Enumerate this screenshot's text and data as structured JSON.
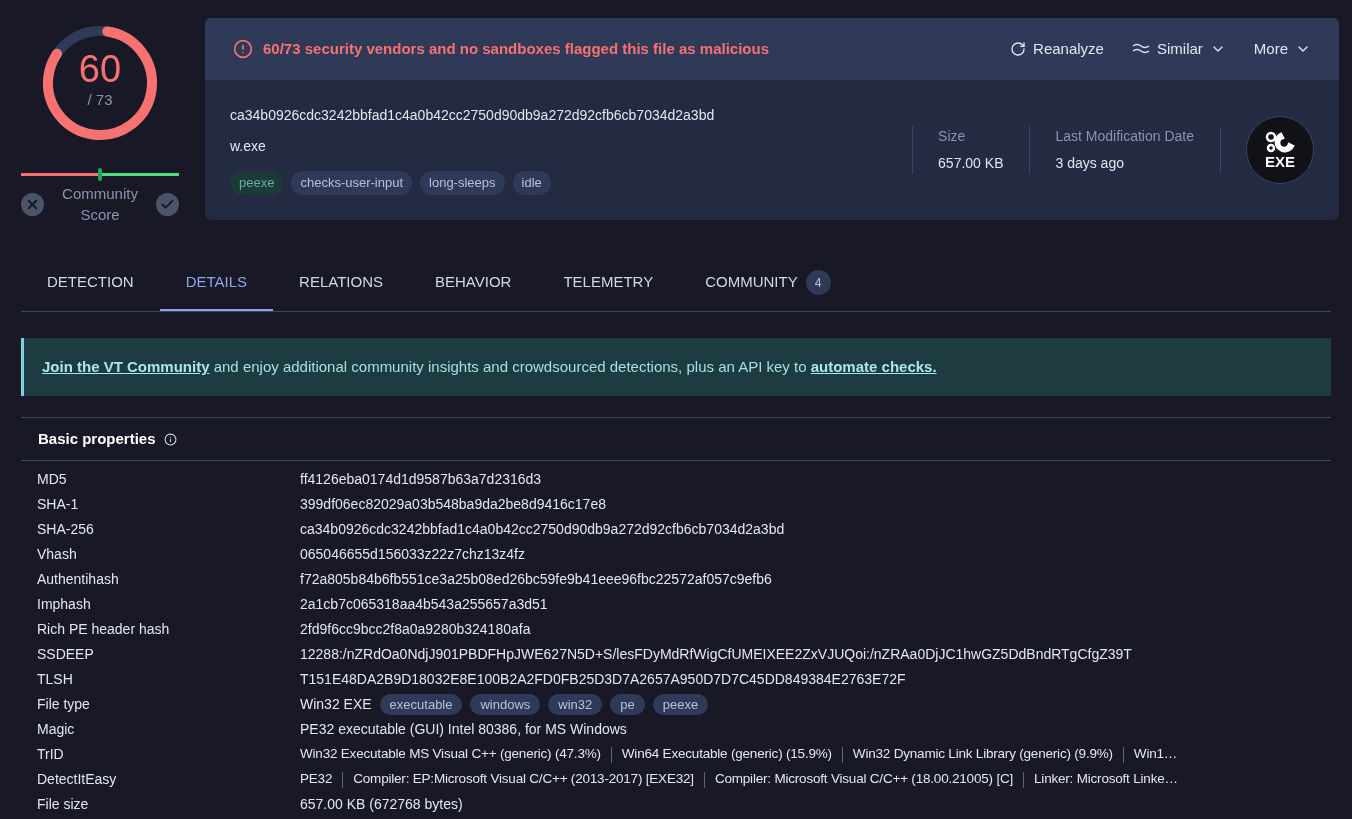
{
  "score": {
    "value": "60",
    "total": "/ 73",
    "level": 0.822
  },
  "community": {
    "label": "Community Score",
    "level": 0.5
  },
  "alert": {
    "text": "60/73 security vendors and no sandboxes flagged this file as malicious"
  },
  "actions": [
    {
      "label": "Reanalyze",
      "kind": "reanalyze"
    },
    {
      "label": "Similar",
      "kind": "similar"
    },
    {
      "label": "More",
      "kind": "more"
    }
  ],
  "file": {
    "hash": "ca34b0926cdc3242bbfad1c4a0b42cc2750d90db9a272d92cfb6cb7034d2a3bd",
    "name": "w.exe",
    "tags": [
      {
        "label": "peexe",
        "kind": "highlight"
      },
      {
        "label": "checks-user-input",
        "kind": "default"
      },
      {
        "label": "long-sleeps",
        "kind": "default"
      },
      {
        "label": "idle",
        "kind": "default"
      }
    ],
    "meta": [
      {
        "label": "Size",
        "value": "657.00 KB"
      },
      {
        "label": "Last Modification Date",
        "value": "3 days ago"
      }
    ],
    "type_badge": "EXE"
  },
  "tabs": [
    {
      "label": "DETECTION",
      "selected": false
    },
    {
      "label": "DETAILS",
      "selected": true
    },
    {
      "label": "RELATIONS",
      "selected": false
    },
    {
      "label": "BEHAVIOR",
      "selected": false
    },
    {
      "label": "TELEMETRY",
      "selected": false
    },
    {
      "label": "COMMUNITY",
      "selected": false,
      "count": "4"
    }
  ],
  "banner": [
    {
      "text": "Join the VT Community",
      "link": true
    },
    {
      "text": " and enjoy additional community insights and crowdsourced detections, plus an API key to ",
      "link": false
    },
    {
      "text": "automate checks.",
      "link": true
    }
  ],
  "properties": {
    "title": "Basic properties",
    "rows": [
      {
        "label": "MD5",
        "kind": "text",
        "value": "ff4126eba0174d1d9587b63a7d2316d3"
      },
      {
        "label": "SHA-1",
        "kind": "text",
        "value": "399df06ec82029a03b548ba9da2be8d9416c17e8"
      },
      {
        "label": "SHA-256",
        "kind": "text",
        "value": "ca34b0926cdc3242bbfad1c4a0b42cc2750d90db9a272d92cfb6cb7034d2a3bd"
      },
      {
        "label": "Vhash",
        "kind": "text",
        "value": "065046655d156033z22z7chz13z4fz"
      },
      {
        "label": "Authentihash",
        "kind": "text",
        "value": "f72a805b84b6fb551ce3a25b08ed26bc59fe9b41eee96fbc22572af057c9efb6"
      },
      {
        "label": "Imphash",
        "kind": "text",
        "value": "2a1cb7c065318aa4b543a255657a3d51"
      },
      {
        "label": "Rich PE header hash",
        "kind": "text",
        "value": "2fd9f6cc9bcc2f8a0a9280b324180afa"
      },
      {
        "label": "SSDEEP",
        "kind": "text",
        "value": "12288:/nZRdOa0NdjJ901PBDFHpJWE627N5D+S/lesFDyMdRfWigCfUMEIXEE2ZxVJUQoi:/nZRAa0DjJC1hwGZ5DdBndRTgCfgZ39T"
      },
      {
        "label": "TLSH",
        "kind": "text",
        "value": "T151E48DA2B9D18032E8E100B2A2FD0FB25D3D7A2657A950D7D7C45DD849384E2763E72F"
      },
      {
        "label": "File type",
        "kind": "tags",
        "value": "Win32 EXE",
        "tags": [
          "executable",
          "windows",
          "win32",
          "pe",
          "peexe"
        ]
      },
      {
        "label": "Magic",
        "kind": "text",
        "value": "PE32 executable (GUI) Intel 80386, for MS Windows"
      },
      {
        "label": "TrID",
        "kind": "list",
        "values": [
          "Win32 Executable MS Visual C++ (generic) (47.3%)",
          "Win64 Executable (generic) (15.9%)",
          "Win32 Dynamic Link Library (generic) (9.9%)",
          "Win1…"
        ]
      },
      {
        "label": "DetectItEasy",
        "kind": "list",
        "values": [
          "PE32",
          "Compiler: EP:Microsoft Visual C/C++ (2013-2017) [EXE32]",
          "Compiler: Microsoft Visual C/C++ (18.00.21005) [C]",
          "Linker: Microsoft Linke…"
        ]
      },
      {
        "label": "File size",
        "kind": "text",
        "value": "657.00 KB (672768 bytes)"
      }
    ]
  }
}
